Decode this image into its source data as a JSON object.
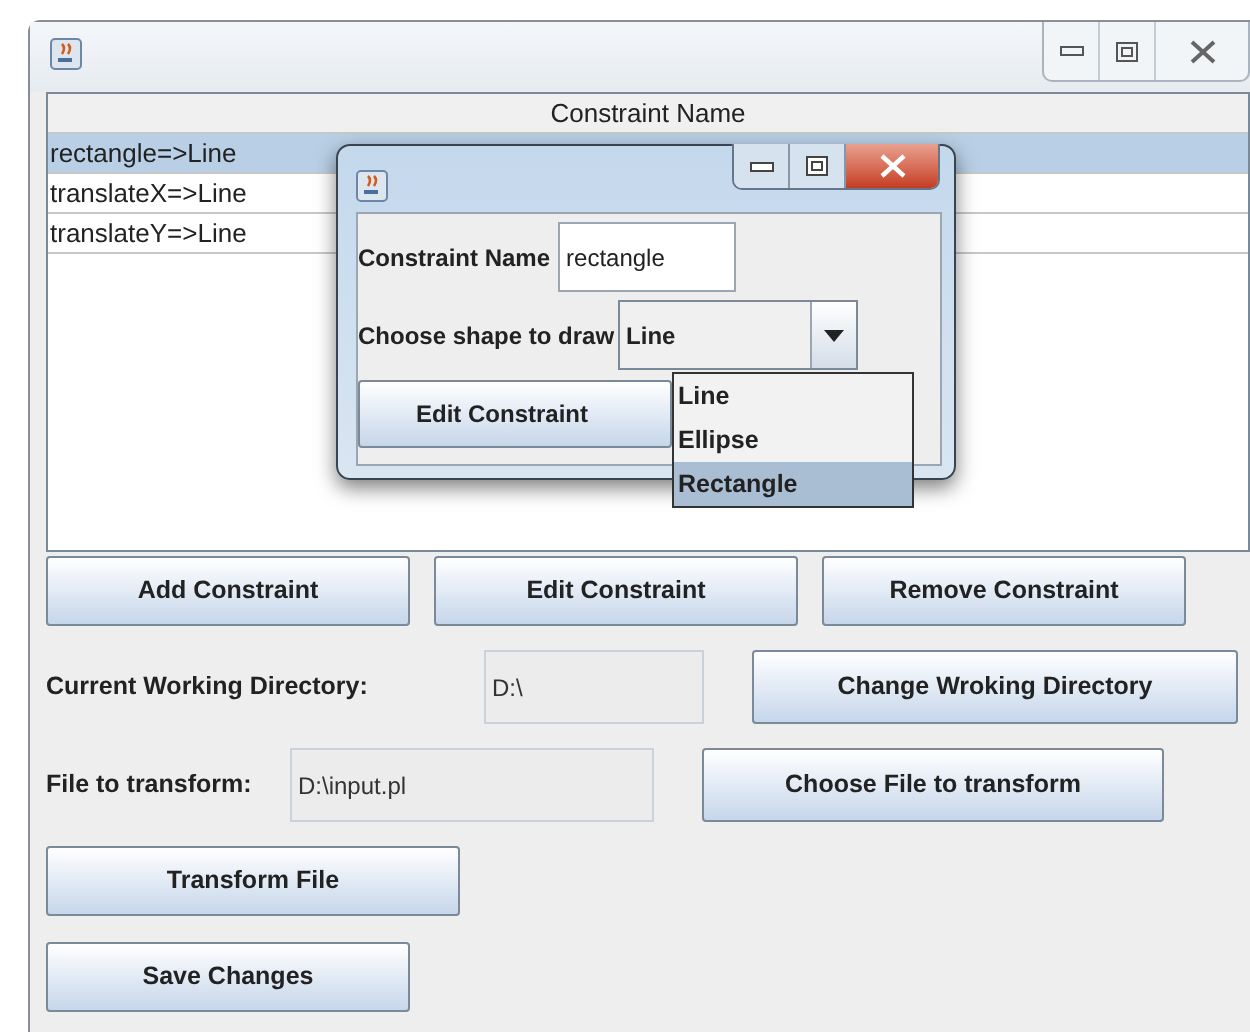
{
  "table": {
    "columns": [
      "Constraint Name"
    ],
    "rows": [
      {
        "text": "rectangle=>Line",
        "selected": true
      },
      {
        "text": "translateX=>Line",
        "selected": false
      },
      {
        "text": "translateY=>Line",
        "selected": false
      }
    ]
  },
  "buttons": [
    "Add Constraint",
    "Edit Constraint",
    "Remove Constraint"
  ],
  "working_directory": {
    "label": "Current Working Directory:",
    "value": "D:\\",
    "disabled": true,
    "button": "Change Wroking Directory"
  },
  "file_to_transform": {
    "label": "File to transform:",
    "value": "D:\\input.pl",
    "disabled": true,
    "button": "Choose File to transform"
  },
  "actions": [
    "Transform File",
    "Save Changes"
  ],
  "dialog": {
    "name_label": "Constraint Name",
    "name_value": "rectangle",
    "shape_label": "Choose shape to draw",
    "shape_value": "Line",
    "button": "Edit Constraint",
    "options": [
      {
        "label": "Line",
        "selected": false
      },
      {
        "label": "Ellipse",
        "selected": false
      },
      {
        "label": "Rectangle",
        "selected": true
      }
    ]
  }
}
